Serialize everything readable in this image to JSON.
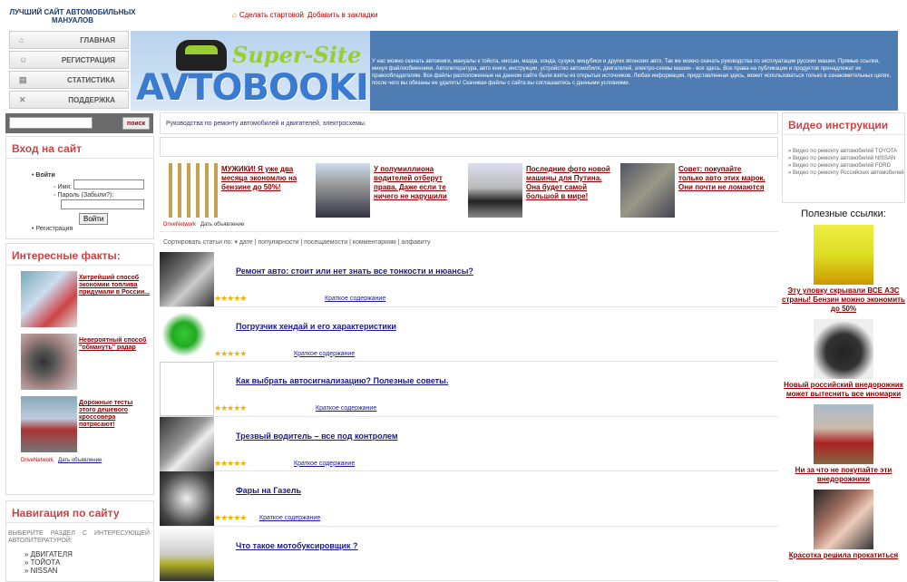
{
  "header": {
    "site_title": "ЛУЧШИЙ САЙТ АВТОМОБИЛЬНЫХ МАНУАЛОВ",
    "make_home": "Сделать стартовой",
    "bookmark": "Добавить в закладки"
  },
  "nav": [
    "ГЛАВНАЯ",
    "РЕГИСТРАЦИЯ",
    "СТАТИСТИКА",
    "ПОДДЕРЖКА"
  ],
  "logo": {
    "super": "Super-Site",
    "main": "AVTOBOOKI.RU"
  },
  "banner_text": "У нас можно скачать автокниги, мануалы к тойота, ниссан, мазда, хонда, сузуки, мицубиси и других японских авто. Так же можно скачать руководства по эксплуатации русских машин. Прямые ссылки, минуя файлообменники. Автолитература, авто книги, инструкции, устройство автомобиля, двигателей, электро-схемы машин - все здесь. Все права на публикации и продуктов принадлежат их правообладателям. Все файлы расположенные на данном сайте были взяты из открытых источников. Любая информация, представленная здесь, может использоваться только в ознакомительных целях, после чего вы обязаны ее удалить! Скачивая файлы с сайта вы соглашаетесь с данными условиями.",
  "search": {
    "button": "поиск"
  },
  "login": {
    "title": "Вход на сайт",
    "enter": "Войти",
    "name_label": "Имя:",
    "pass_label": "Пароль (Забыли?):",
    "submit": "Войти",
    "register": "Регистрация"
  },
  "facts": {
    "title": "Интересные факты:",
    "items": [
      "Хитрейший способ экономии топлива придумали в России...",
      "Невероятный способ \"обмануть\" радар",
      "Дорожные тесты этого дешевого кроссовера потрясают!"
    ],
    "drive_network": "DriveNetwork",
    "post_ad": "Дать объявление"
  },
  "site_nav": {
    "title": "Навигация по сайту",
    "intro": "Выберите раздел с интересующей автолитературой:",
    "items": [
      "ДВИГАТЕЛЯ",
      "ТОЙОТА",
      "NISSAN"
    ]
  },
  "breadcrumb": "Руководства по ремонту автомобилей и двигателей, электросхемы.",
  "ads": [
    "МУЖИКИ! Я уже два месяца экономлю на бензине до 50%!",
    "У полумиллиона водителей отберут права. Даже если те ничего не нарушили",
    "Последние фото новой машины для Путина. Она будет самой большой в мире!",
    "Совет: покупайте только авто этих марок. Они почти не ломаются"
  ],
  "ads_drive_network": "DriveNetwork",
  "ads_post": "Дать объявление",
  "sort": {
    "label": "Сортировать статьи по:",
    "options": [
      "дате",
      "популярности",
      "посещаемости",
      "комментариям",
      "алфавиту"
    ]
  },
  "articles": [
    "Ремонт авто: стоит или нет знать все тонкости и нюансы?",
    "Погрузчик хендай и его характеристики",
    "Как выбрать автосигнализацию? Полезные советы.",
    "Трезвый водитель – все под контролем",
    "Фары на Газель",
    "Что такое мотобуксировщик ?"
  ],
  "summary_label": "Краткое содержание",
  "stars": "★★★★★",
  "video": {
    "title": "Видео инструкции",
    "items": [
      "» Видео по ремонту автомобилей TOYOTA",
      "» Видео по ремонту автомобилей NISSAN",
      "» Видео по ремонту автомобилей FORD",
      "» Видео по ремонту Российских автомобилей"
    ]
  },
  "useful": {
    "title": "Полезные ссылки:",
    "items": [
      "Эту уловку скрывали ВСЕ АЗС страны! Бензин можно экономить до 50%",
      "Новый российский внедорожник может вытеснить все иномарки",
      "Ни за что не покупайте эти внедорожники",
      "Красотка решила прокатиться"
    ]
  }
}
